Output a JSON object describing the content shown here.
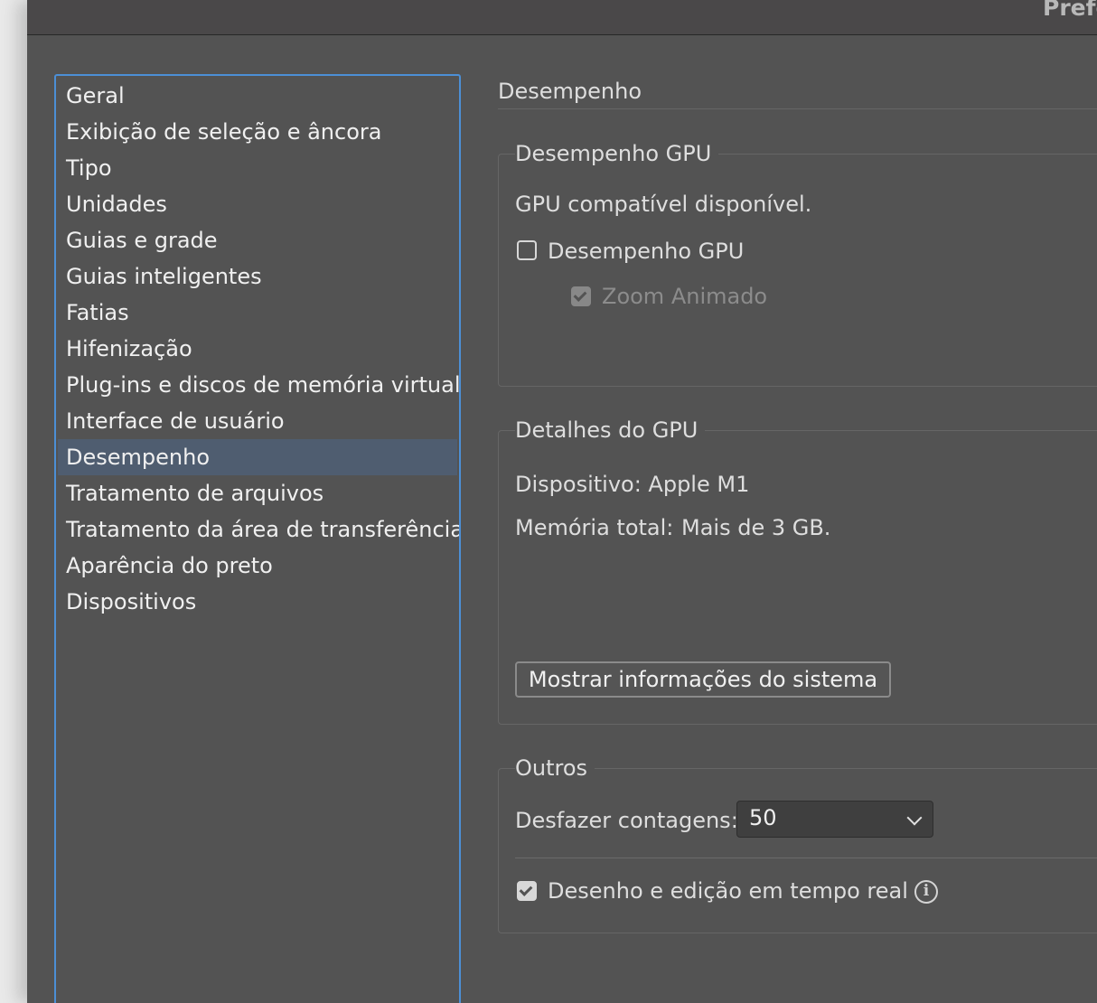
{
  "window": {
    "title": "Prefe"
  },
  "sidebar": {
    "items": [
      {
        "label": "Geral",
        "selected": false
      },
      {
        "label": "Exibição de seleção e âncora",
        "selected": false
      },
      {
        "label": "Tipo",
        "selected": false
      },
      {
        "label": "Unidades",
        "selected": false
      },
      {
        "label": "Guias e grade",
        "selected": false
      },
      {
        "label": "Guias inteligentes",
        "selected": false
      },
      {
        "label": "Fatias",
        "selected": false
      },
      {
        "label": "Hifenização",
        "selected": false
      },
      {
        "label": "Plug-ins e discos de memória virtual",
        "selected": false
      },
      {
        "label": "Interface de usuário",
        "selected": false
      },
      {
        "label": "Desempenho",
        "selected": true
      },
      {
        "label": "Tratamento de arquivos",
        "selected": false
      },
      {
        "label": "Tratamento da área de transferência",
        "selected": false
      },
      {
        "label": "Aparência do preto",
        "selected": false
      },
      {
        "label": "Dispositivos",
        "selected": false
      }
    ]
  },
  "main": {
    "heading": "Desempenho",
    "gpu_performance": {
      "title": "Desempenho GPU",
      "status": "GPU compatível disponível.",
      "checkbox_label": "Desempenho GPU",
      "checked": false,
      "zoom_label": "Zoom Animado",
      "zoom_checked": true,
      "zoom_disabled": true
    },
    "gpu_details": {
      "title": "Detalhes do GPU",
      "device": "Dispositivo: Apple M1",
      "memory_label": "Memória total:",
      "memory_value": "Mais de 3 GB.",
      "button_label": "Mostrar informações do sistema"
    },
    "others": {
      "title": "Outros",
      "undo_label": "Desfazer contagens:",
      "undo_value": "50",
      "live_drawing_label": "Desenho e edição em tempo real",
      "live_drawing_checked": true,
      "info_icon": "info-icon"
    }
  },
  "colors": {
    "background": "#535353",
    "selection": "#4f5d70",
    "focus_border": "#4c8fd6",
    "text": "#dedede"
  }
}
